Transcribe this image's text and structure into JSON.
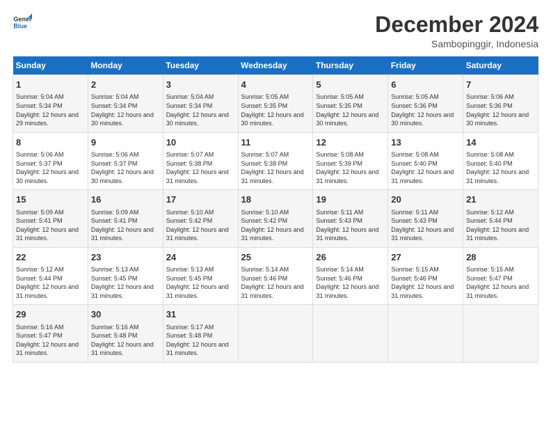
{
  "logo": {
    "line1": "General",
    "line2": "Blue"
  },
  "title": "December 2024",
  "subtitle": "Sambopinggir, Indonesia",
  "headers": [
    "Sunday",
    "Monday",
    "Tuesday",
    "Wednesday",
    "Thursday",
    "Friday",
    "Saturday"
  ],
  "weeks": [
    [
      {
        "day": "1",
        "rise": "5:04 AM",
        "set": "5:34 PM",
        "dl": "12 hours and 29 minutes"
      },
      {
        "day": "2",
        "rise": "5:04 AM",
        "set": "5:34 PM",
        "dl": "12 hours and 30 minutes"
      },
      {
        "day": "3",
        "rise": "5:04 AM",
        "set": "5:34 PM",
        "dl": "12 hours and 30 minutes"
      },
      {
        "day": "4",
        "rise": "5:05 AM",
        "set": "5:35 PM",
        "dl": "12 hours and 30 minutes"
      },
      {
        "day": "5",
        "rise": "5:05 AM",
        "set": "5:35 PM",
        "dl": "12 hours and 30 minutes"
      },
      {
        "day": "6",
        "rise": "5:05 AM",
        "set": "5:36 PM",
        "dl": "12 hours and 30 minutes"
      },
      {
        "day": "7",
        "rise": "5:06 AM",
        "set": "5:36 PM",
        "dl": "12 hours and 30 minutes"
      }
    ],
    [
      {
        "day": "8",
        "rise": "5:06 AM",
        "set": "5:37 PM",
        "dl": "12 hours and 30 minutes"
      },
      {
        "day": "9",
        "rise": "5:06 AM",
        "set": "5:37 PM",
        "dl": "12 hours and 30 minutes"
      },
      {
        "day": "10",
        "rise": "5:07 AM",
        "set": "5:38 PM",
        "dl": "12 hours and 31 minutes"
      },
      {
        "day": "11",
        "rise": "5:07 AM",
        "set": "5:38 PM",
        "dl": "12 hours and 31 minutes"
      },
      {
        "day": "12",
        "rise": "5:08 AM",
        "set": "5:39 PM",
        "dl": "12 hours and 31 minutes"
      },
      {
        "day": "13",
        "rise": "5:08 AM",
        "set": "5:40 PM",
        "dl": "12 hours and 31 minutes"
      },
      {
        "day": "14",
        "rise": "5:08 AM",
        "set": "5:40 PM",
        "dl": "12 hours and 31 minutes"
      }
    ],
    [
      {
        "day": "15",
        "rise": "5:09 AM",
        "set": "5:41 PM",
        "dl": "12 hours and 31 minutes"
      },
      {
        "day": "16",
        "rise": "5:09 AM",
        "set": "5:41 PM",
        "dl": "12 hours and 31 minutes"
      },
      {
        "day": "17",
        "rise": "5:10 AM",
        "set": "5:42 PM",
        "dl": "12 hours and 31 minutes"
      },
      {
        "day": "18",
        "rise": "5:10 AM",
        "set": "5:42 PM",
        "dl": "12 hours and 31 minutes"
      },
      {
        "day": "19",
        "rise": "5:11 AM",
        "set": "5:43 PM",
        "dl": "12 hours and 31 minutes"
      },
      {
        "day": "20",
        "rise": "5:11 AM",
        "set": "5:43 PM",
        "dl": "12 hours and 31 minutes"
      },
      {
        "day": "21",
        "rise": "5:12 AM",
        "set": "5:44 PM",
        "dl": "12 hours and 31 minutes"
      }
    ],
    [
      {
        "day": "22",
        "rise": "5:12 AM",
        "set": "5:44 PM",
        "dl": "12 hours and 31 minutes"
      },
      {
        "day": "23",
        "rise": "5:13 AM",
        "set": "5:45 PM",
        "dl": "12 hours and 31 minutes"
      },
      {
        "day": "24",
        "rise": "5:13 AM",
        "set": "5:45 PM",
        "dl": "12 hours and 31 minutes"
      },
      {
        "day": "25",
        "rise": "5:14 AM",
        "set": "5:46 PM",
        "dl": "12 hours and 31 minutes"
      },
      {
        "day": "26",
        "rise": "5:14 AM",
        "set": "5:46 PM",
        "dl": "12 hours and 31 minutes"
      },
      {
        "day": "27",
        "rise": "5:15 AM",
        "set": "5:46 PM",
        "dl": "12 hours and 31 minutes"
      },
      {
        "day": "28",
        "rise": "5:15 AM",
        "set": "5:47 PM",
        "dl": "12 hours and 31 minutes"
      }
    ],
    [
      {
        "day": "29",
        "rise": "5:16 AM",
        "set": "5:47 PM",
        "dl": "12 hours and 31 minutes"
      },
      {
        "day": "30",
        "rise": "5:16 AM",
        "set": "5:48 PM",
        "dl": "12 hours and 31 minutes"
      },
      {
        "day": "31",
        "rise": "5:17 AM",
        "set": "5:48 PM",
        "dl": "12 hours and 31 minutes"
      },
      null,
      null,
      null,
      null
    ]
  ],
  "labels": {
    "sunrise": "Sunrise:",
    "sunset": "Sunset:",
    "daylight": "Daylight:"
  }
}
